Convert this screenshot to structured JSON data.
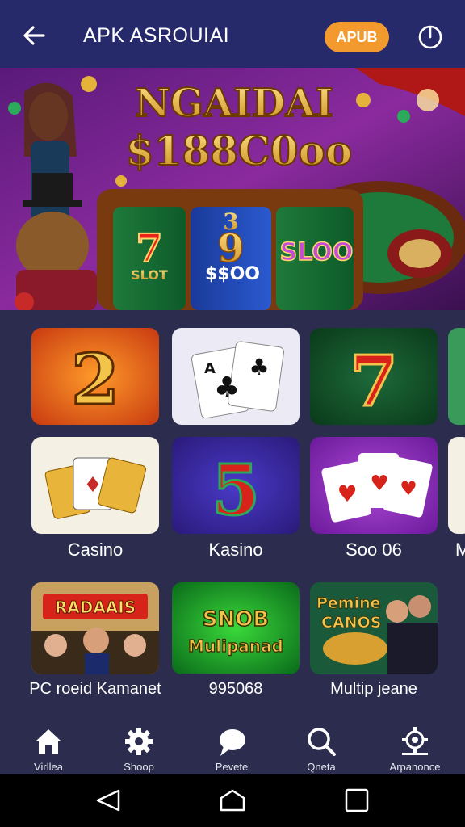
{
  "header": {
    "title": "APK ASROUIAI",
    "pill_label": "APUB"
  },
  "banner": {
    "headline": "NGAIDAI",
    "amount": "$188C0oo",
    "reels": [
      "7",
      "3",
      "9",
      "SLOO"
    ],
    "reel_sub": [
      "SLOT",
      "$$OO"
    ]
  },
  "tiles": {
    "row1": [
      {
        "glyph": "2"
      },
      {
        "glyph": "A"
      },
      {
        "glyph": "7"
      }
    ],
    "row2": [
      {
        "label": "Casino"
      },
      {
        "glyph": "5",
        "label": "Kasino"
      },
      {
        "label": "Soo 06"
      },
      {
        "label": "M"
      }
    ],
    "row3": [
      {
        "title": "RADAAIS",
        "label": "PC roeid Kamanet"
      },
      {
        "title": "SNOB Mulipanad",
        "label": "995068"
      },
      {
        "title": "Pemine CANOS",
        "label": "Multip jeane"
      }
    ]
  },
  "nav": {
    "items": [
      {
        "label": "Virllea",
        "icon": "home-icon"
      },
      {
        "label": "Shoop",
        "icon": "gear-icon"
      },
      {
        "label": "Pevete",
        "icon": "chat-icon"
      },
      {
        "label": "Qneta",
        "icon": "search-icon"
      },
      {
        "label": "Arpanonce",
        "icon": "settings-icon"
      }
    ]
  },
  "colors": {
    "header_bg": "#262a6a",
    "body_bg": "#2b2c4e",
    "pill": "#f39a2e"
  }
}
